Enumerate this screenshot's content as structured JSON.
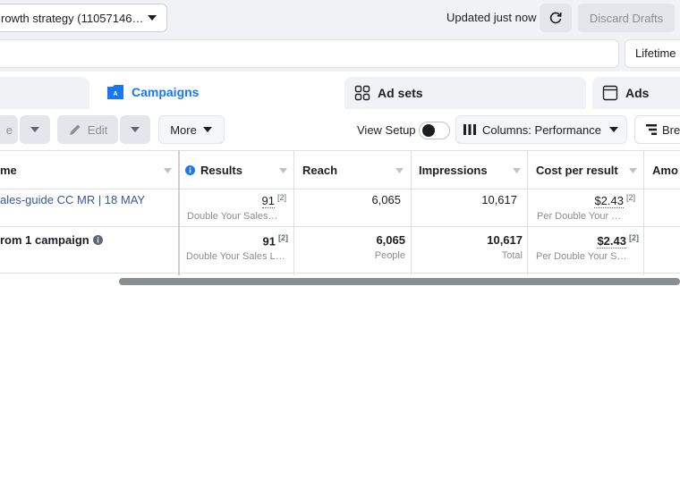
{
  "topbar": {
    "account_selector": "rowth strategy (11057146…",
    "updated_text": "Updated just now",
    "discard_label": "Discard Drafts",
    "date_range_label": "Lifetime"
  },
  "tabs": [
    {
      "label": ""
    },
    {
      "label": "Campaigns"
    },
    {
      "label": "Ad sets"
    },
    {
      "label": "Ads"
    }
  ],
  "toolbar": {
    "create_label": "e",
    "edit_label": "Edit",
    "more_label": "More",
    "view_setup_label": "View Setup",
    "columns_label": "Columns: Performance",
    "breakdown_label": "Bre"
  },
  "table": {
    "headers": {
      "name": "me",
      "results": "Results",
      "reach": "Reach",
      "impressions": "Impressions",
      "cost_per_result": "Cost per result",
      "amount": "Amo"
    },
    "rows": [
      {
        "name": "ales-guide CC MR | 18 MAY",
        "results": "91",
        "results_footnote": "[2]",
        "results_sub": "Double Your Sales…",
        "reach": "6,065",
        "impressions": "10,617",
        "cost": "$2.43",
        "cost_footnote": "[2]",
        "cost_sub": "Per Double Your S…"
      }
    ],
    "summary": {
      "name": "rom 1 campaign",
      "results": "91",
      "results_footnote": "[2]",
      "results_sub": "Double Your Sales L…",
      "reach": "6,065",
      "reach_sub": "People",
      "impressions": "10,617",
      "impressions_sub": "Total",
      "cost": "$2.43",
      "cost_footnote": "[2]",
      "cost_sub": "Per Double Your Sal…"
    }
  },
  "colors": {
    "accent": "#1877f2",
    "link": "#385898",
    "muted": "#8a8d91"
  }
}
